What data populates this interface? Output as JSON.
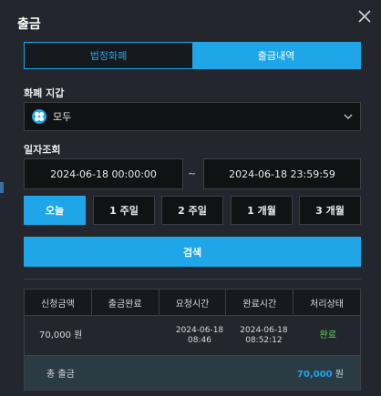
{
  "modal": {
    "title": "출금",
    "close_icon": "close-icon"
  },
  "tabs": [
    {
      "label": "법정화폐",
      "active": false
    },
    {
      "label": "출금내역",
      "active": true
    }
  ],
  "wallet": {
    "label": "화폐 지갑",
    "selected": "모두",
    "icon": "grid-coin-icon"
  },
  "date_filter": {
    "label": "일자조회",
    "start": "2024-06-18 00:00:00",
    "separator": "~",
    "end": "2024-06-18 23:59:59"
  },
  "periods": [
    {
      "label": "오늘",
      "active": true
    },
    {
      "label": "1 주일",
      "active": false
    },
    {
      "label": "2 주일",
      "active": false
    },
    {
      "label": "1 개월",
      "active": false
    },
    {
      "label": "3 개월",
      "active": false
    }
  ],
  "search_label": "검색",
  "table": {
    "headers": [
      "신청금액",
      "출금완료",
      "요청시간",
      "완료시간",
      "처리상태"
    ],
    "rows": [
      {
        "amount": "70,000 원",
        "completed": "",
        "request_date": "2024-06-18",
        "request_time": "08:46",
        "complete_date": "2024-06-18",
        "complete_time": "08:52:12",
        "status": "완료"
      }
    ],
    "total_label": "총 출금",
    "total_value": "70,000",
    "total_unit": " 원"
  },
  "colors": {
    "accent": "#1fa6e8",
    "status_ok": "#5cd35c",
    "background": "#23272d"
  }
}
